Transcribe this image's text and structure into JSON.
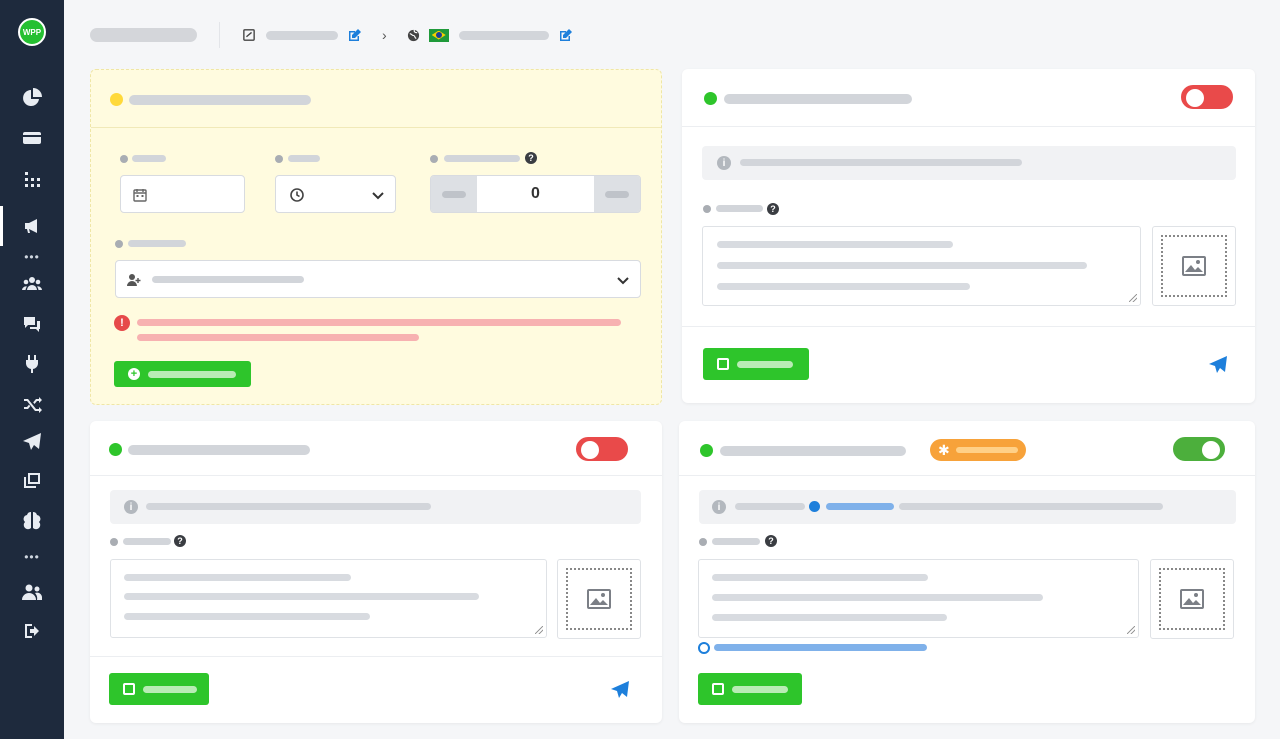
{
  "app": {
    "logo_text": "WPP"
  },
  "sidebar": {
    "items": [
      {
        "icon": "pie-chart-icon"
      },
      {
        "icon": "credit-card-icon"
      },
      {
        "icon": "grid-icon"
      },
      {
        "icon": "megaphone-icon",
        "active": true
      },
      {
        "icon": "users-icon"
      },
      {
        "icon": "chat-icon"
      },
      {
        "icon": "plug-icon"
      },
      {
        "icon": "shuffle-icon"
      },
      {
        "icon": "send-icon"
      },
      {
        "icon": "windows-icon"
      },
      {
        "icon": "brain-icon"
      },
      {
        "icon": "user-group-icon"
      },
      {
        "icon": "logout-icon"
      }
    ]
  },
  "scheduler": {
    "quantity_value": "0"
  },
  "colors": {
    "accent_green": "#2ec52b",
    "toggle_off_red": "#e94a4a",
    "toggle_on_green": "#4caf3c",
    "link_blue": "#1d7fdb",
    "badge_orange": "#f7a23a",
    "sidebar_bg": "#1e2a3d"
  }
}
